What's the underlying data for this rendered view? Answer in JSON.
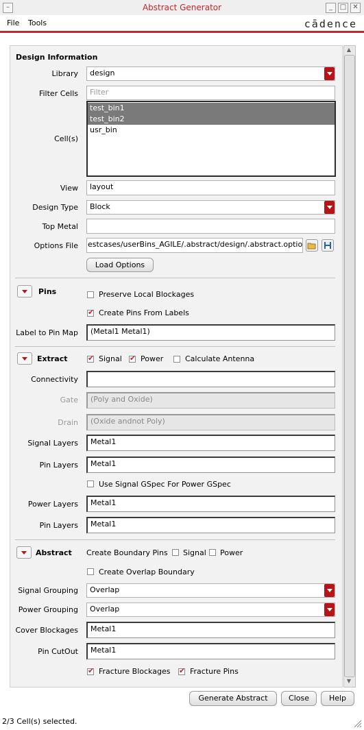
{
  "window": {
    "title": "Abstract Generator",
    "buttons": [
      "_",
      "□",
      "✕"
    ]
  },
  "menubar": {
    "items": [
      "File",
      "Tools"
    ],
    "brand": "cādence"
  },
  "design": {
    "heading": "Design Information",
    "library_label": "Library",
    "library_value": "design",
    "filter_label": "Filter Cells",
    "filter_placeholder": "Filter",
    "cells_label": "Cell(s)",
    "cells": [
      {
        "name": "test_bin1",
        "selected": true
      },
      {
        "name": "test_bin2",
        "selected": true
      },
      {
        "name": "usr_bin",
        "selected": false
      }
    ],
    "view_label": "View",
    "view_value": "layout",
    "design_type_label": "Design Type",
    "design_type_value": "Block",
    "top_metal_label": "Top Metal",
    "top_metal_value": "",
    "options_file_label": "Options File",
    "options_file_value": "estcases/userBins_AGILE/.abstract/design/.abstract.options",
    "load_options": "Load Options"
  },
  "pins": {
    "heading": "Pins",
    "preserve_local": {
      "label": "Preserve Local Blockages",
      "checked": false
    },
    "create_pins": {
      "label": "Create Pins From Labels",
      "checked": true
    },
    "label_map_label": "Label to Pin Map",
    "label_map_value": "(Metal1 Metal1)"
  },
  "extract": {
    "heading": "Extract",
    "signal": {
      "label": "Signal",
      "checked": true
    },
    "power": {
      "label": "Power",
      "checked": true
    },
    "antenna": {
      "label": "Calculate Antenna",
      "checked": false
    },
    "connectivity_label": "Connectivity",
    "connectivity_value": "",
    "gate_label": "Gate",
    "gate_value": "(Poly and Oxide)",
    "drain_label": "Drain",
    "drain_value": "(Oxide andnot Poly)",
    "signal_layers_label": "Signal Layers",
    "signal_layers_value": "Metal1",
    "pin_layers_label": "Pin Layers",
    "pin_layers_value": "Metal1",
    "use_signal_gspec": {
      "label": "Use Signal GSpec For Power GSpec",
      "checked": false
    },
    "power_layers_label": "Power Layers",
    "power_layers_value": "Metal1",
    "pin_layers2_label": "Pin Layers",
    "pin_layers2_value": "Metal1"
  },
  "abstract": {
    "heading": "Abstract",
    "boundary_label": "Create Boundary Pins",
    "boundary_signal": {
      "label": "Signal",
      "checked": false
    },
    "boundary_power": {
      "label": "Power",
      "checked": false
    },
    "overlap_boundary": {
      "label": "Create Overlap Boundary",
      "checked": false
    },
    "signal_grouping_label": "Signal Grouping",
    "signal_grouping_value": "Overlap",
    "power_grouping_label": "Power Grouping",
    "power_grouping_value": "Overlap",
    "cover_blockages_label": "Cover Blockages",
    "cover_blockages_value": "Metal1",
    "pin_cutout_label": "Pin CutOut",
    "pin_cutout_value": "Metal1",
    "fracture_blockages": {
      "label": "Fracture Blockages",
      "checked": true
    },
    "fracture_pins": {
      "label": "Fracture Pins",
      "checked": true
    }
  },
  "actions": {
    "generate": "Generate Abstract",
    "close": "Close",
    "help": "Help"
  },
  "status": "2/3 Cell(s) selected.",
  "colors": {
    "accent": "#c0282d",
    "dropdown": "#b51418"
  }
}
